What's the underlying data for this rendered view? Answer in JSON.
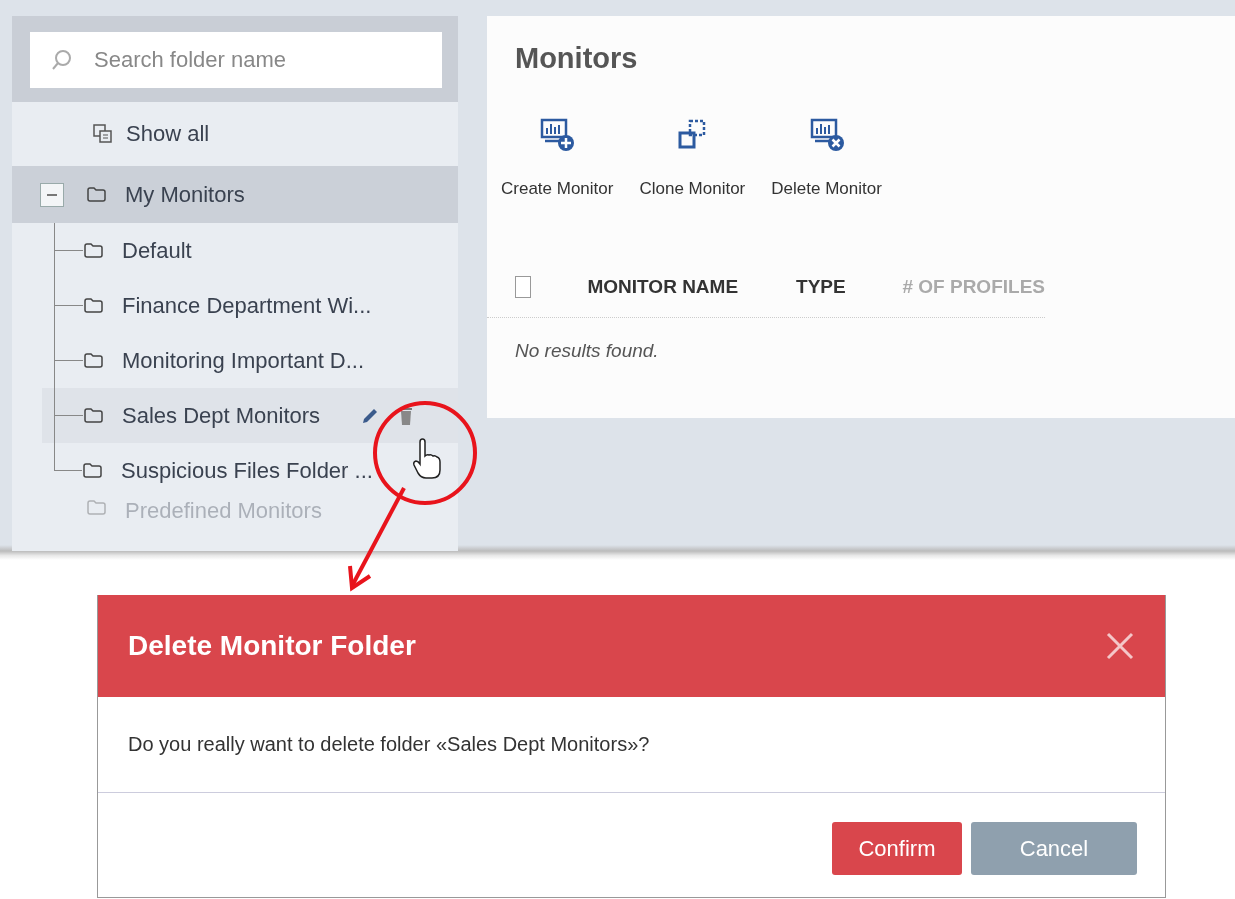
{
  "sidebar": {
    "search": {
      "placeholder": "Search folder name"
    },
    "show_all": "Show all",
    "tree": [
      {
        "label": "My Monitors",
        "expanded": true,
        "selected": true,
        "children": [
          {
            "label": "Default",
            "selected": false,
            "hovered": false
          },
          {
            "label": "Finance Department Wi...",
            "selected": false,
            "hovered": false
          },
          {
            "label": "Monitoring Important D...",
            "selected": false,
            "hovered": false
          },
          {
            "label": "Sales Dept Monitors",
            "selected": false,
            "hovered": true
          },
          {
            "label": "Suspicious Files Folder ...",
            "selected": false,
            "hovered": false
          }
        ]
      },
      {
        "label": "Predefined Monitors",
        "selected": false
      }
    ]
  },
  "main": {
    "title": "Monitors",
    "toolbar": [
      {
        "kind": "create",
        "label": "Create Monitor"
      },
      {
        "kind": "clone",
        "label": "Clone Monitor"
      },
      {
        "kind": "delete",
        "label": "Delete Monitor"
      }
    ],
    "table": {
      "all_checked": false,
      "columns": [
        "MONITOR NAME",
        "TYPE",
        "# OF PROFILES"
      ],
      "empty_message": "No results found."
    }
  },
  "dialog": {
    "title": "Delete Monitor Folder",
    "message": "Do you really want to delete folder «Sales Dept Monitors»?",
    "buttons": [
      {
        "kind": "primary",
        "label": "Confirm"
      },
      {
        "kind": "secondary",
        "label": "Cancel"
      }
    ]
  }
}
